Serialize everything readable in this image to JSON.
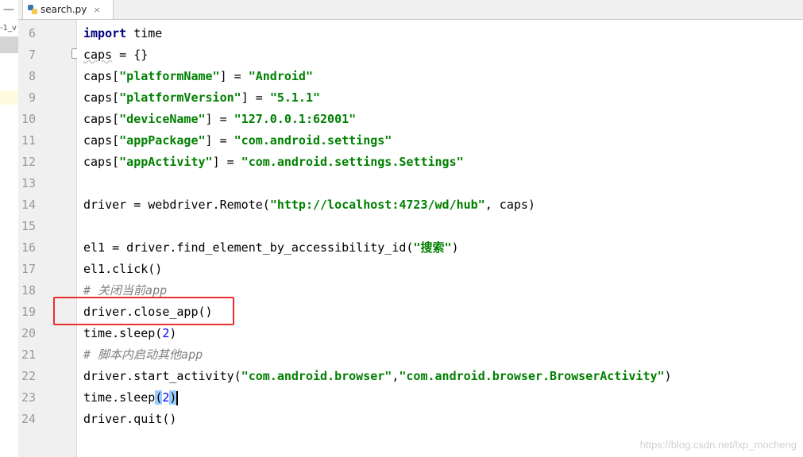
{
  "tab": {
    "filename": "search.py",
    "icon": "python-file-icon",
    "close_label": "×"
  },
  "left_panel": {
    "collapse_label": "—",
    "fragment": "-1_v"
  },
  "lines": [
    {
      "num": "6",
      "segments": [
        {
          "t": "import",
          "c": "kw"
        },
        {
          "t": " time",
          "c": ""
        }
      ]
    },
    {
      "num": "7",
      "segments": [
        {
          "t": "caps",
          "c": "underline-warn"
        },
        {
          "t": " = {}",
          "c": ""
        }
      ]
    },
    {
      "num": "8",
      "segments": [
        {
          "t": "caps[",
          "c": ""
        },
        {
          "t": "\"platformName\"",
          "c": "str"
        },
        {
          "t": "] = ",
          "c": ""
        },
        {
          "t": "\"Android\"",
          "c": "str"
        }
      ]
    },
    {
      "num": "9",
      "segments": [
        {
          "t": "caps[",
          "c": ""
        },
        {
          "t": "\"platformVersion\"",
          "c": "str"
        },
        {
          "t": "] = ",
          "c": ""
        },
        {
          "t": "\"5.1.1\"",
          "c": "str"
        }
      ]
    },
    {
      "num": "10",
      "segments": [
        {
          "t": "caps[",
          "c": ""
        },
        {
          "t": "\"deviceName\"",
          "c": "str"
        },
        {
          "t": "] = ",
          "c": ""
        },
        {
          "t": "\"127.0.0.1:62001\"",
          "c": "str"
        }
      ]
    },
    {
      "num": "11",
      "segments": [
        {
          "t": "caps[",
          "c": ""
        },
        {
          "t": "\"appPackage\"",
          "c": "str"
        },
        {
          "t": "] = ",
          "c": ""
        },
        {
          "t": "\"com.android.settings\"",
          "c": "str"
        }
      ]
    },
    {
      "num": "12",
      "segments": [
        {
          "t": "caps[",
          "c": ""
        },
        {
          "t": "\"appActivity\"",
          "c": "str"
        },
        {
          "t": "] = ",
          "c": ""
        },
        {
          "t": "\"com.android.settings.Settings\"",
          "c": "str"
        }
      ]
    },
    {
      "num": "13",
      "segments": []
    },
    {
      "num": "14",
      "segments": [
        {
          "t": "driver = webdriver.Remote(",
          "c": ""
        },
        {
          "t": "\"http://localhost:4723/wd/hub\"",
          "c": "str"
        },
        {
          "t": ", caps)",
          "c": ""
        }
      ]
    },
    {
      "num": "15",
      "segments": []
    },
    {
      "num": "16",
      "segments": [
        {
          "t": "el1 = driver.find_element_by_accessibility_id(",
          "c": ""
        },
        {
          "t": "\"搜索\"",
          "c": "str"
        },
        {
          "t": ")",
          "c": ""
        }
      ]
    },
    {
      "num": "17",
      "segments": [
        {
          "t": "el1.click()",
          "c": ""
        }
      ]
    },
    {
      "num": "18",
      "segments": [
        {
          "t": "# 关闭当前app",
          "c": "cmt"
        }
      ]
    },
    {
      "num": "19",
      "segments": [
        {
          "t": "driver.close_app()",
          "c": ""
        }
      ]
    },
    {
      "num": "20",
      "segments": [
        {
          "t": "time.sleep(",
          "c": ""
        },
        {
          "t": "2",
          "c": "num"
        },
        {
          "t": ")",
          "c": ""
        }
      ]
    },
    {
      "num": "21",
      "segments": [
        {
          "t": "# 脚本内启动其他app",
          "c": "cmt"
        }
      ]
    },
    {
      "num": "22",
      "segments": [
        {
          "t": "driver.start_activity(",
          "c": ""
        },
        {
          "t": "\"com.android.browser\"",
          "c": "str"
        },
        {
          "t": ",",
          "c": ""
        },
        {
          "t": "\"com.android.browser.BrowserActivity\"",
          "c": "str"
        },
        {
          "t": ")",
          "c": ""
        }
      ]
    },
    {
      "num": "23",
      "segments": [
        {
          "t": "time.sleep",
          "c": ""
        },
        {
          "t": "(",
          "c": "paren-hl"
        },
        {
          "t": "2",
          "c": "num"
        },
        {
          "t": ")",
          "c": "paren-hl"
        }
      ],
      "caret": true,
      "current": true
    },
    {
      "num": "24",
      "segments": [
        {
          "t": "driver.quit()",
          "c": ""
        }
      ]
    }
  ],
  "annotation": {
    "highlighted_line": "19",
    "color": "#e8312e"
  },
  "watermark": "https://blog.csdn.net/lxp_mocheng",
  "colors": {
    "keyword": "#000080",
    "string": "#008000",
    "number": "#0000ff",
    "comment": "#808080",
    "current_line": "#fffbe0"
  }
}
